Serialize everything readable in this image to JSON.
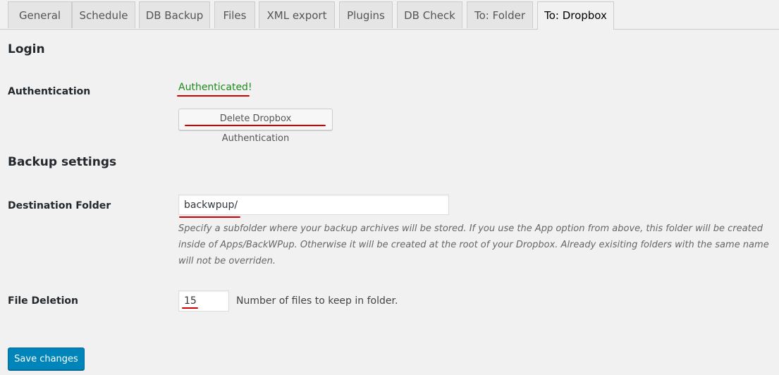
{
  "tabs": [
    {
      "label": "General"
    },
    {
      "label": "Schedule"
    },
    {
      "label": "DB Backup"
    },
    {
      "label": "Files"
    },
    {
      "label": "XML export"
    },
    {
      "label": "Plugins"
    },
    {
      "label": "DB Check"
    },
    {
      "label": "To: Folder"
    },
    {
      "label": "To: Dropbox"
    }
  ],
  "active_tab": "To: Dropbox",
  "login": {
    "heading": "Login",
    "authentication_label": "Authentication",
    "status": "Authenticated!",
    "delete_button": "Delete Dropbox Authentication"
  },
  "backup": {
    "heading": "Backup settings",
    "destination_label": "Destination Folder",
    "destination_value": "backwpup/",
    "destination_description": "Specify a subfolder where your backup archives will be stored. If you use the App option from above, this folder will be created inside of Apps/BackWPup. Otherwise it will be created at the root of your Dropbox. Already exisiting folders with the same name will not be overriden.",
    "deletion_label": "File Deletion",
    "deletion_value": "15",
    "deletion_suffix": "Number of files to keep in folder."
  },
  "save_button": "Save changes",
  "colors": {
    "accent": "#0085ba",
    "success": "#1e8a1e",
    "annotation": "#d40000"
  }
}
